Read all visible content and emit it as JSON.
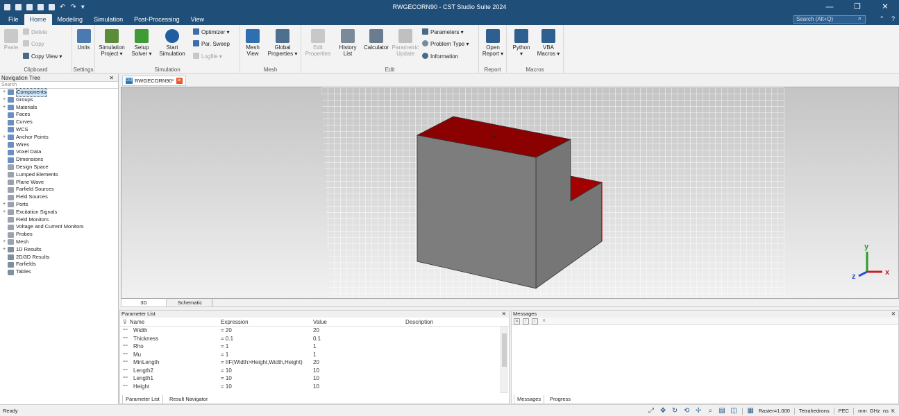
{
  "window": {
    "title": "RWGECORN90 - CST Studio Suite 2024",
    "minimize": "—",
    "maximize": "❐",
    "close": "✕"
  },
  "menu": {
    "tabs": [
      "File",
      "Home",
      "Modeling",
      "Simulation",
      "Post-Processing",
      "View"
    ],
    "active": "Home",
    "search_placeholder": "Search (Alt+Q)",
    "help": "?"
  },
  "ribbon": {
    "clipboard": {
      "label": "Clipboard",
      "paste": "Paste",
      "delete": "Delete",
      "copy": "Copy",
      "copy_view": "Copy View"
    },
    "settings": {
      "label": "Settings",
      "units": "Units"
    },
    "simulation": {
      "label": "Simulation",
      "sim_project": "Simulation\nProject",
      "setup_solver": "Setup\nSolver",
      "start_sim": "Start\nSimulation",
      "optimizer": "Optimizer",
      "par_sweep": "Par. Sweep",
      "logfile": "Logfile"
    },
    "mesh": {
      "label": "Mesh",
      "mesh_view": "Mesh\nView",
      "global_props": "Global\nProperties"
    },
    "edit": {
      "label": "Edit",
      "edit_props": "Edit\nProperties",
      "history": "History\nList",
      "calculator": "Calculator",
      "param_update": "Parametric\nUpdate",
      "parameters": "Parameters",
      "problem_type": "Problem Type",
      "information": "Information"
    },
    "report": {
      "label": "Report",
      "open_report": "Open\nReport"
    },
    "macros": {
      "label": "Macros",
      "python": "Python",
      "vba": "VBA\nMacros"
    }
  },
  "nav": {
    "title": "Navigation Tree",
    "close": "✕",
    "search": "Search",
    "items": [
      {
        "label": "Components",
        "exp": "+",
        "selected": true,
        "color": "#6a8fc2"
      },
      {
        "label": "Groups",
        "exp": "+",
        "color": "#6a8fc2"
      },
      {
        "label": "Materials",
        "exp": "+",
        "color": "#6a8fc2"
      },
      {
        "label": "Faces",
        "exp": "",
        "color": "#6a8fc2"
      },
      {
        "label": "Curves",
        "exp": "",
        "color": "#6a8fc2"
      },
      {
        "label": "WCS",
        "exp": "",
        "color": "#6a8fc2"
      },
      {
        "label": "Anchor Points",
        "exp": "+",
        "color": "#6a8fc2"
      },
      {
        "label": "Wires",
        "exp": "",
        "color": "#6a8fc2"
      },
      {
        "label": "Voxel Data",
        "exp": "",
        "color": "#6a8fc2"
      },
      {
        "label": "Dimensions",
        "exp": "",
        "color": "#6a8fc2"
      },
      {
        "label": "Design Space",
        "exp": "",
        "color": "#9aa3ad"
      },
      {
        "label": "Lumped Elements",
        "exp": "",
        "color": "#9aa3ad"
      },
      {
        "label": "Plane Wave",
        "exp": "",
        "color": "#9aa3ad"
      },
      {
        "label": "Farfield Sources",
        "exp": "",
        "color": "#9aa3ad"
      },
      {
        "label": "Field Sources",
        "exp": "",
        "color": "#9aa3ad"
      },
      {
        "label": "Ports",
        "exp": "+",
        "color": "#9aa3ad"
      },
      {
        "label": "Excitation Signals",
        "exp": "+",
        "color": "#9aa3ad"
      },
      {
        "label": "Field Monitors",
        "exp": "",
        "color": "#9aa3ad"
      },
      {
        "label": "Voltage and Current Monitors",
        "exp": "",
        "color": "#9aa3ad"
      },
      {
        "label": "Probes",
        "exp": "",
        "color": "#9aa3ad"
      },
      {
        "label": "Mesh",
        "exp": "+",
        "color": "#9aa3ad"
      },
      {
        "label": "1D Results",
        "exp": "+",
        "color": "#7f8fa0"
      },
      {
        "label": "2D/3D Results",
        "exp": "",
        "color": "#7f8fa0"
      },
      {
        "label": "Farfields",
        "exp": "",
        "color": "#7f8fa0"
      },
      {
        "label": "Tables",
        "exp": "",
        "color": "#7f8fa0"
      }
    ]
  },
  "doc": {
    "tab": "RWGECORN90*",
    "badge": "CST",
    "close": "✕"
  },
  "viewport": {
    "tabs": [
      "3D",
      "Schematic"
    ],
    "axes": {
      "x": "x",
      "y": "y",
      "z": "z"
    }
  },
  "params": {
    "title": "Parameter List",
    "close": "✕",
    "columns": [
      "Name",
      "Expression",
      "Value",
      "Description"
    ],
    "rows": [
      {
        "name": "Width",
        "expr": "= 20",
        "value": "20"
      },
      {
        "name": "Thickness",
        "expr": "= 0.1",
        "value": "0.1"
      },
      {
        "name": "Rho",
        "expr": "= 1",
        "value": "1"
      },
      {
        "name": "Mu",
        "expr": "= 1",
        "value": "1"
      },
      {
        "name": "MinLength",
        "expr": "= IIF(Width>Height,Width,Height)",
        "value": "20"
      },
      {
        "name": "Length2",
        "expr": "= 10",
        "value": "10"
      },
      {
        "name": "Length1",
        "expr": "= 10",
        "value": "10"
      },
      {
        "name": "Height",
        "expr": "= 10",
        "value": "10"
      }
    ],
    "tabs": [
      "Parameter List",
      "Result Navigator"
    ]
  },
  "messages": {
    "title": "Messages",
    "close": "✕",
    "tabs": [
      "Messages",
      "Progress"
    ]
  },
  "status": {
    "left": "Ready",
    "raster": "Raster=1.000",
    "mesh": "Tetrahedrons",
    "bc": "PEC",
    "units": "mm  GHz  ns  K"
  },
  "colors": {
    "title_bg": "#1f4e79",
    "part": "#808080",
    "face": "#8b0000",
    "grid": "#ffffff"
  }
}
